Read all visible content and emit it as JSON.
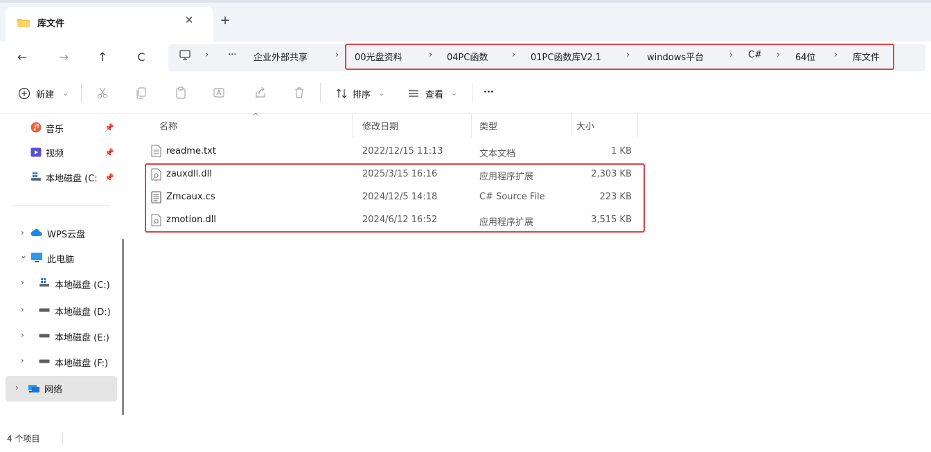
{
  "tab": {
    "title": "库文件",
    "close_glyph": "✕",
    "new_glyph": "+"
  },
  "nav": {
    "back": "←",
    "forward": "→",
    "up": "↑",
    "refresh": "C"
  },
  "address": {
    "more": "···",
    "crumbs": [
      "企业外部共享",
      "00光盘资料",
      "04PC函数",
      "01PC函数库V2.1",
      "windows平台",
      "C#",
      "64位",
      "库文件"
    ],
    "separator": "›"
  },
  "toolbar": {
    "new_label": "新建",
    "sort_label": "排序",
    "view_label": "查看",
    "more_label": "···",
    "dropdown_glyph": "⌄"
  },
  "sidebar": {
    "pinned": [
      {
        "label": "音乐",
        "icon": "music-icon"
      },
      {
        "label": "视频",
        "icon": "video-icon"
      },
      {
        "label": "本地磁盘 (C:",
        "icon": "drive-c-icon"
      }
    ],
    "tree": [
      {
        "label": "WPS云盘",
        "icon": "cloud-icon",
        "chevron": "›"
      },
      {
        "label": "此电脑",
        "icon": "pc-icon",
        "chevron": "⌄"
      },
      {
        "label": "本地磁盘 (C:)",
        "icon": "system-drive-icon",
        "chevron": "›"
      },
      {
        "label": "本地磁盘 (D:)",
        "icon": "drive-icon",
        "chevron": "›"
      },
      {
        "label": "本地磁盘 (E:)",
        "icon": "drive-icon",
        "chevron": "›"
      },
      {
        "label": "本地磁盘 (F:)",
        "icon": "drive-icon",
        "chevron": "›"
      },
      {
        "label": "网络",
        "icon": "network-icon",
        "chevron": "›"
      }
    ]
  },
  "columns": {
    "name": "名称",
    "date": "修改日期",
    "type": "类型",
    "size": "大小"
  },
  "files": [
    {
      "name": "readme.txt",
      "date": "2022/12/15 11:13",
      "type": "文本文档",
      "size": "1 KB",
      "icon": "text-file-icon"
    },
    {
      "name": "zauxdll.dll",
      "date": "2025/3/15 16:16",
      "type": "应用程序扩展",
      "size": "2,303 KB",
      "icon": "dll-file-icon"
    },
    {
      "name": "Zmcaux.cs",
      "date": "2024/12/5 14:18",
      "type": "C# Source File",
      "size": "223 KB",
      "icon": "cs-file-icon"
    },
    {
      "name": "zmotion.dll",
      "date": "2024/6/12 16:52",
      "type": "应用程序扩展",
      "size": "3,515 KB",
      "icon": "dll-file-icon"
    }
  ],
  "status": {
    "count": "4 个项目"
  },
  "colors": {
    "highlight": "#e0404a",
    "folder": "#f4c542",
    "selected": "#e5e5e5",
    "tabbar": "#f0f4f9"
  }
}
